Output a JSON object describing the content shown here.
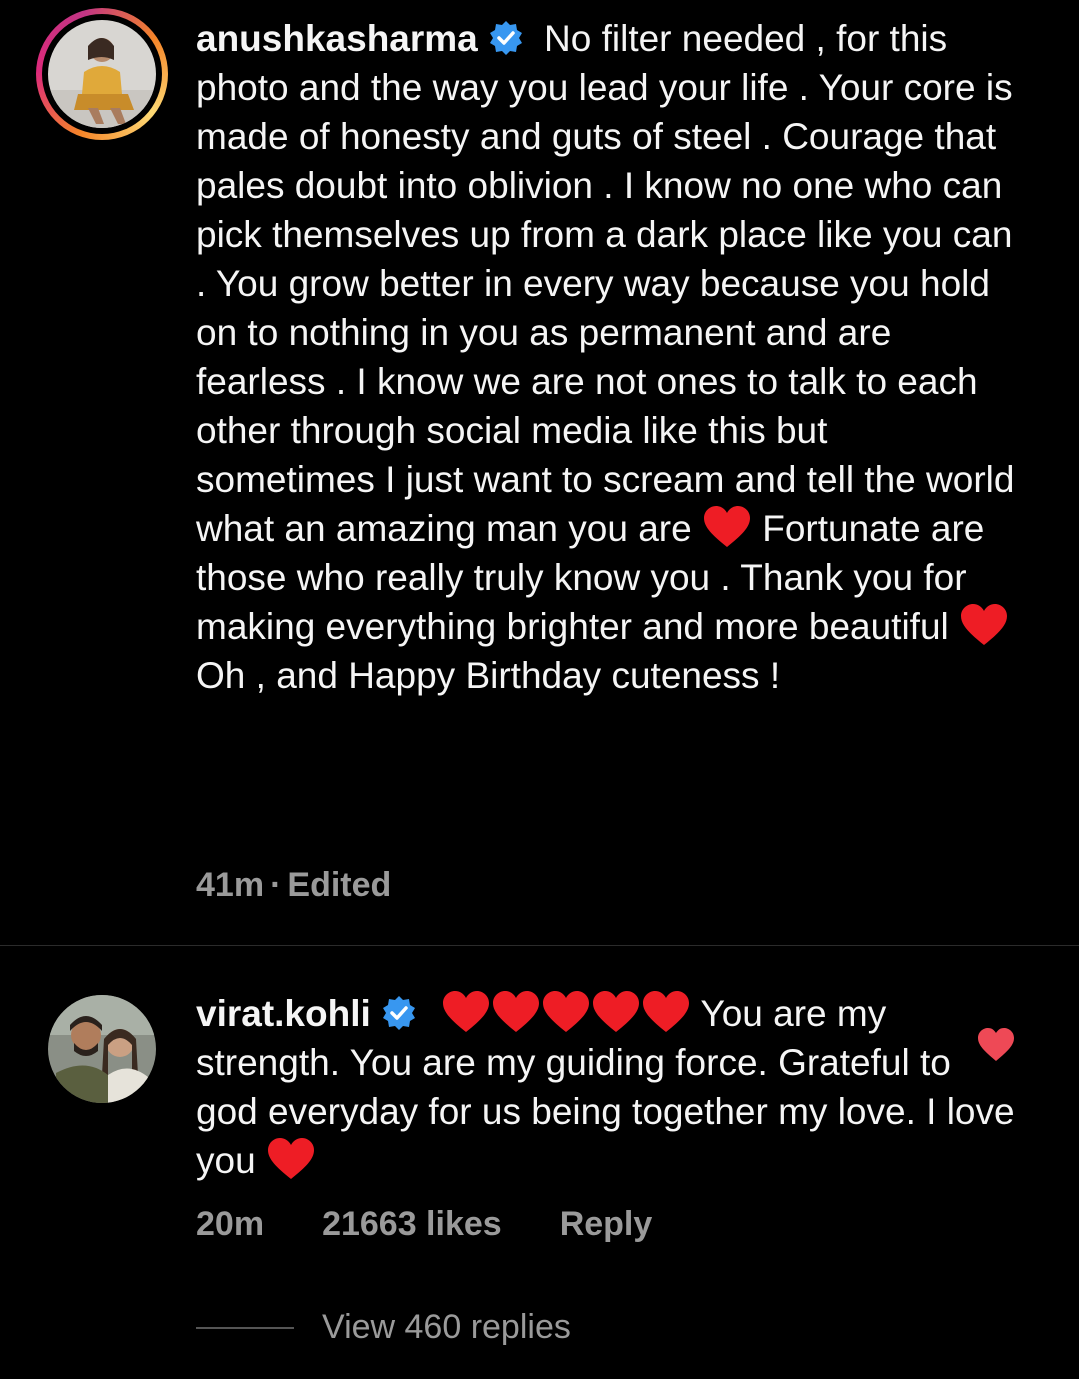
{
  "comments": [
    {
      "username": "anushkasharma",
      "text_parts": [
        "No filter needed , for this photo and the way you lead your life . Your core is made of honesty and guts of steel . Courage that pales doubt into oblivion . I know no one who can pick themselves up from a dark place like you can . You grow better in every way because you hold on to nothing in you as permanent and are fearless . I know we are not ones to talk to each other through social media like this but sometimes I just want to scream and tell the world what an amazing man you are",
        "Fortunate are those who really truly know you . Thank you for making everything brighter and more beautiful",
        "Oh , and Happy Birthday cuteness !"
      ],
      "time": "41m",
      "status": "Edited"
    },
    {
      "username": "virat.kohli",
      "text_parts": [
        "You are my strength. You are my guiding force. Grateful to god everyday for us being together my love. I love you"
      ],
      "time": "20m",
      "likes": "21663 likes",
      "reply_label": "Reply",
      "view_replies": "View 460 replies"
    }
  ],
  "colors": {
    "heart": "#ee1d25",
    "verified": "#3897f0",
    "meta": "#9a9a9a"
  },
  "icons": {
    "verified": "verified-badge-icon",
    "heart": "red-heart-emoji-icon",
    "like": "liked-heart-icon"
  }
}
